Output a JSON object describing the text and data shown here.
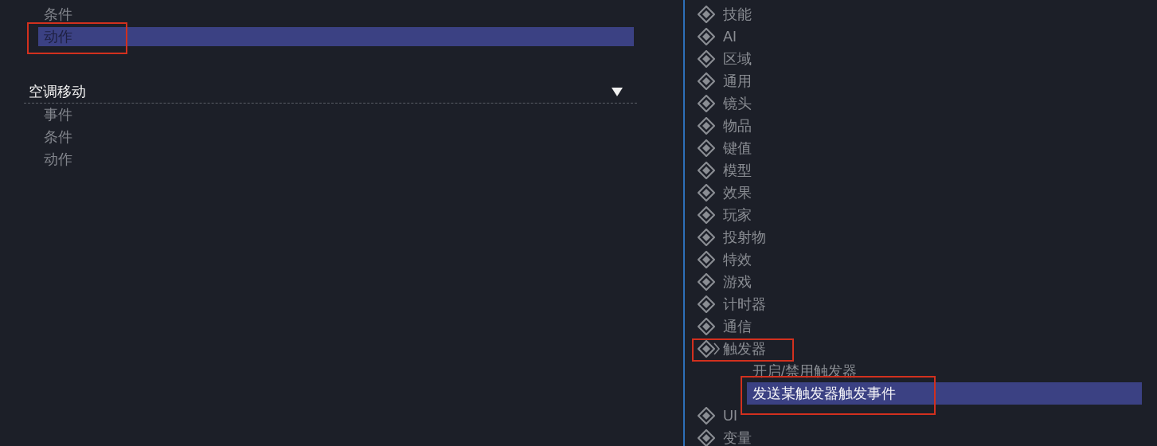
{
  "left_panel": {
    "groups": [
      {
        "items": [
          {
            "label": "条件",
            "selected": false,
            "annotated": false
          },
          {
            "label": "动作",
            "selected": true,
            "annotated": true
          }
        ]
      },
      {
        "title": "空调移动",
        "expanded": true,
        "items": [
          {
            "label": "事件",
            "selected": false,
            "annotated": false
          },
          {
            "label": "条件",
            "selected": false,
            "annotated": false
          },
          {
            "label": "动作",
            "selected": false,
            "annotated": false
          }
        ]
      }
    ]
  },
  "right_panel": {
    "categories": [
      {
        "label": "技能",
        "expanded": false,
        "annotated": false
      },
      {
        "label": "AI",
        "expanded": false,
        "annotated": false
      },
      {
        "label": "区域",
        "expanded": false,
        "annotated": false
      },
      {
        "label": "通用",
        "expanded": false,
        "annotated": false
      },
      {
        "label": "镜头",
        "expanded": false,
        "annotated": false
      },
      {
        "label": "物品",
        "expanded": false,
        "annotated": false
      },
      {
        "label": "键值",
        "expanded": false,
        "annotated": false
      },
      {
        "label": "模型",
        "expanded": false,
        "annotated": false
      },
      {
        "label": "效果",
        "expanded": false,
        "annotated": false
      },
      {
        "label": "玩家",
        "expanded": false,
        "annotated": false
      },
      {
        "label": "投射物",
        "expanded": false,
        "annotated": false
      },
      {
        "label": "特效",
        "expanded": false,
        "annotated": false
      },
      {
        "label": "游戏",
        "expanded": false,
        "annotated": false
      },
      {
        "label": "计时器",
        "expanded": false,
        "annotated": false
      },
      {
        "label": "通信",
        "expanded": false,
        "annotated": false
      },
      {
        "label": "触发器",
        "expanded": true,
        "annotated": true,
        "children": [
          {
            "label": "开启/禁用触发器",
            "selected": false,
            "annotated": false
          },
          {
            "label": "发送某触发器触发事件",
            "selected": true,
            "annotated": true
          }
        ]
      },
      {
        "label": "UI",
        "expanded": false,
        "annotated": false
      },
      {
        "label": "变量",
        "expanded": false,
        "annotated": false
      }
    ]
  }
}
